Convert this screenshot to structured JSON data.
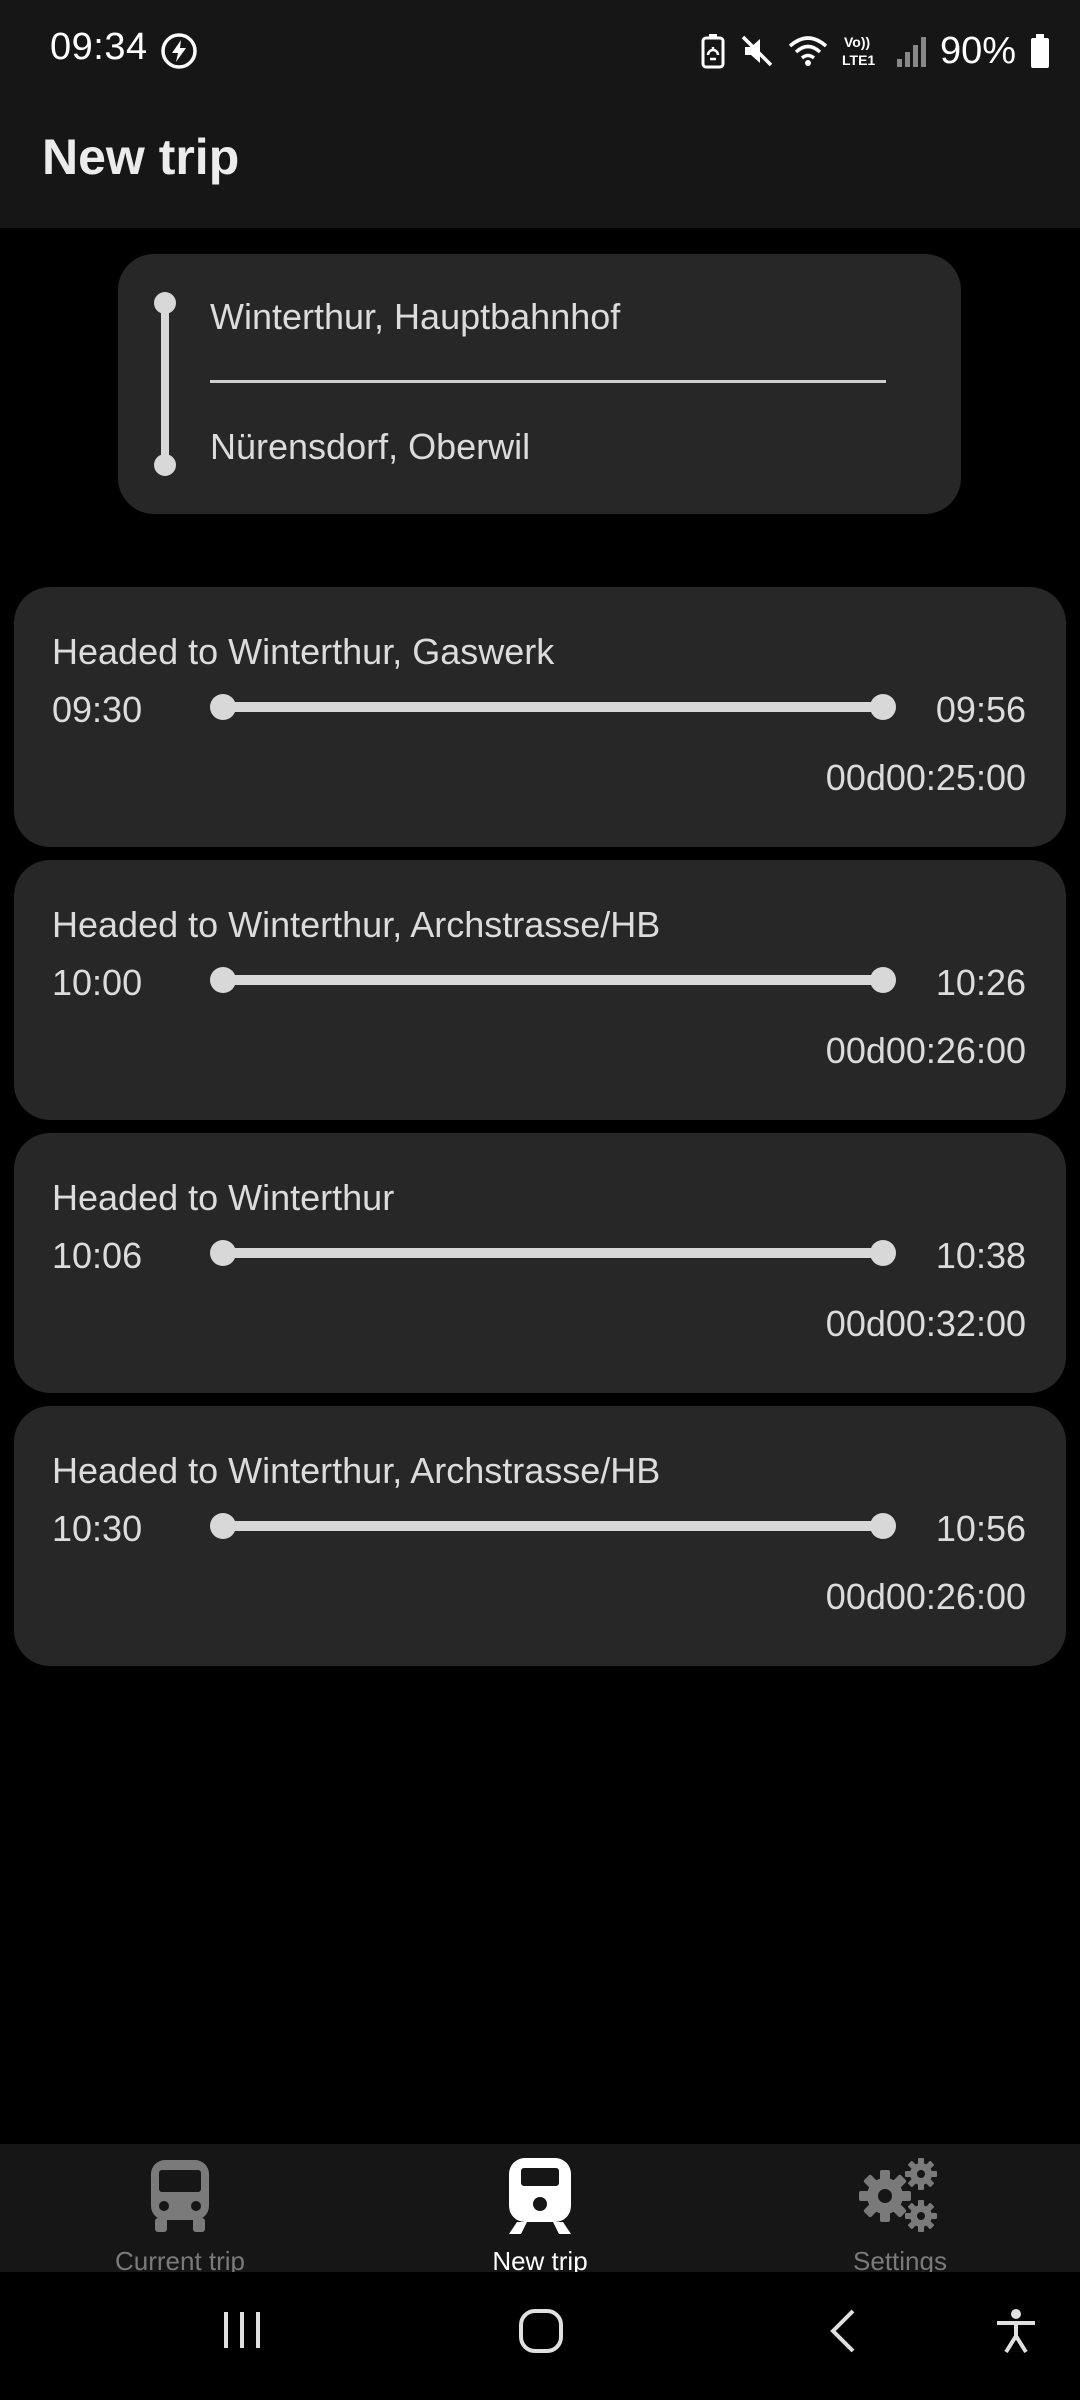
{
  "status_bar": {
    "time": "09:34",
    "battery_percent": "90%",
    "icons": [
      "charging-bolt-icon",
      "battery-saver-icon",
      "mute-icon",
      "wifi-icon",
      "volte-lte-icon",
      "signal-icon",
      "battery-icon"
    ]
  },
  "app_bar": {
    "title": "New trip"
  },
  "route": {
    "from": "Winterthur, Hauptbahnhof",
    "to": "Nürensdorf, Oberwil"
  },
  "trips": [
    {
      "title": "Headed to Winterthur, Gaswerk",
      "departure": "09:30",
      "arrival": "09:56",
      "duration": "00d00:25:00"
    },
    {
      "title": "Headed to Winterthur, Archstrasse/HB",
      "departure": "10:00",
      "arrival": "10:26",
      "duration": "00d00:26:00"
    },
    {
      "title": "Headed to Winterthur",
      "departure": "10:06",
      "arrival": "10:38",
      "duration": "00d00:32:00"
    },
    {
      "title": "Headed to Winterthur, Archstrasse/HB",
      "departure": "10:30",
      "arrival": "10:56",
      "duration": "00d00:26:00"
    }
  ],
  "bottom_nav": {
    "items": [
      {
        "label": "Current trip",
        "icon": "bus-icon",
        "active": false
      },
      {
        "label": "New trip",
        "icon": "train-icon",
        "active": true
      },
      {
        "label": "Settings",
        "icon": "gears-icon",
        "active": false
      }
    ]
  },
  "system_nav": {
    "buttons": [
      "recents-icon",
      "home-icon",
      "back-icon",
      "accessibility-icon"
    ]
  },
  "colors": {
    "background": "#000000",
    "surface": "#272727",
    "bar": "#161616",
    "text": "#dcdcdc",
    "inactive": "#7a7a7a"
  }
}
